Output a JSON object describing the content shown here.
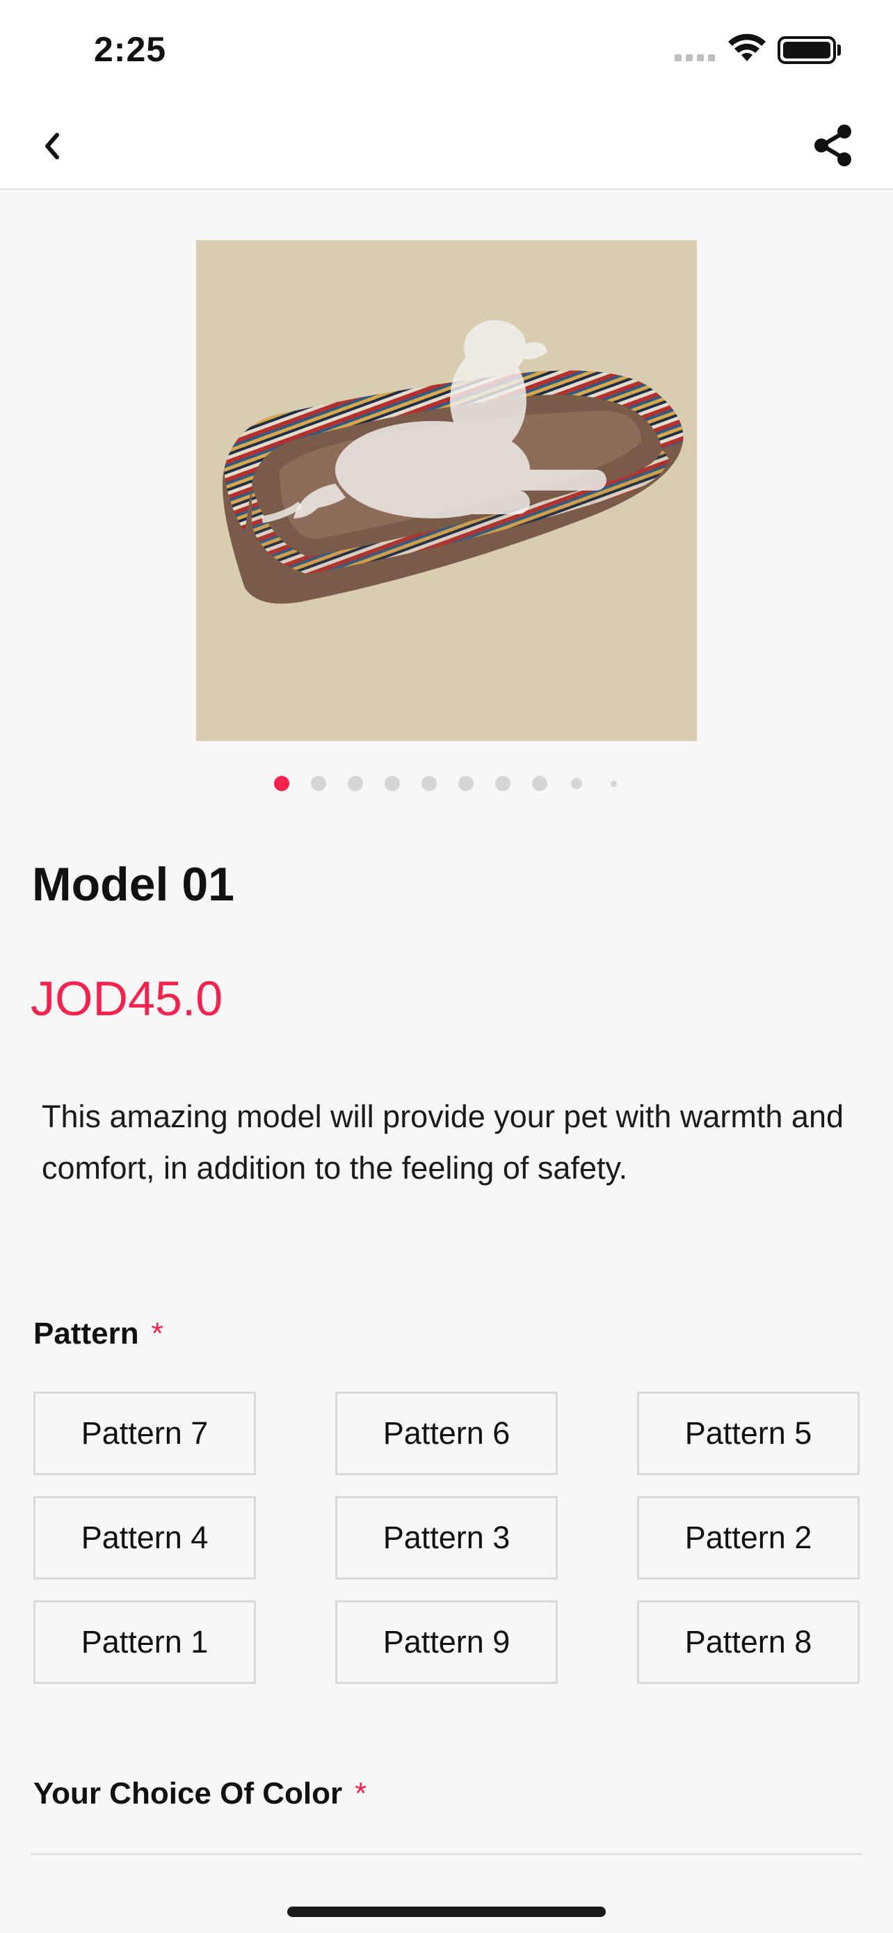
{
  "status_bar": {
    "time": "2:25",
    "signal_icon": "cellular-signal-icon",
    "wifi_icon": "wifi-icon",
    "battery_icon": "battery-icon"
  },
  "nav": {
    "back_icon": "chevron-left-icon",
    "share_icon": "share-icon"
  },
  "gallery": {
    "image_count": 10,
    "active_index": 0,
    "accent_color": "#f5224e"
  },
  "product": {
    "title": "Model 01",
    "price": "JOD45.0",
    "description": "This amazing model will provide your pet with warmth and comfort, in addition to the feeling of safety."
  },
  "pattern_section": {
    "label": "Pattern",
    "required_mark": "*",
    "options": [
      "Pattern 7",
      "Pattern 6",
      "Pattern 5",
      "Pattern 4",
      "Pattern 3",
      "Pattern 2",
      "Pattern 1",
      "Pattern 9",
      "Pattern 8"
    ]
  },
  "color_section": {
    "label": "Your Choice Of Color",
    "required_mark": "*"
  }
}
